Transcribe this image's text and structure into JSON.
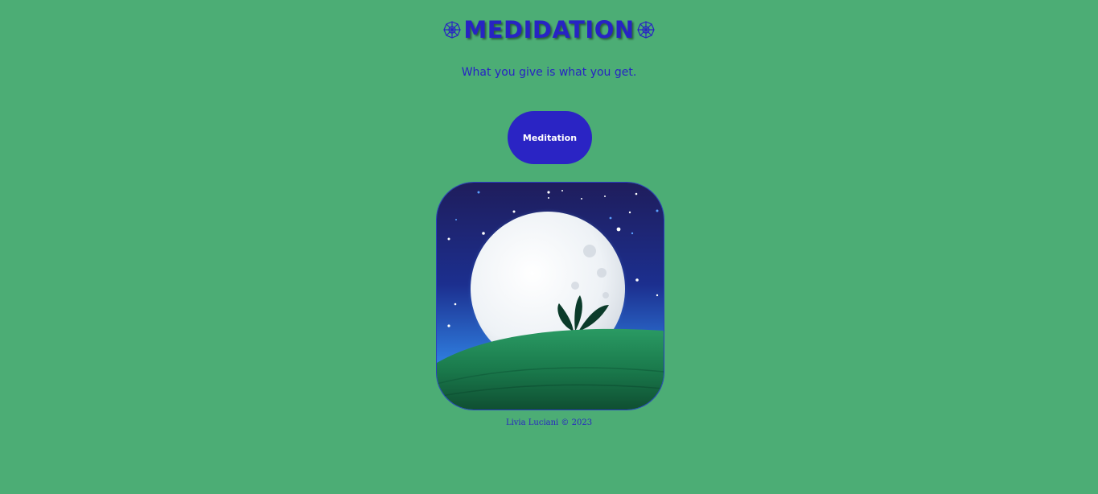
{
  "header": {
    "title": "MEDIDATION",
    "subtitle": "What you give is what you get.",
    "ornament_icon": "snowflake-ornament-icon",
    "title_color": "#2723c4"
  },
  "main": {
    "button_label": "Meditation",
    "button_color": "#2a24c4",
    "image": {
      "subject": "moon-over-hill-illustration"
    }
  },
  "footer": {
    "credit": "Livia Luciani © 2023"
  },
  "colors": {
    "background": "#4cad75",
    "accent": "#2723c4"
  }
}
